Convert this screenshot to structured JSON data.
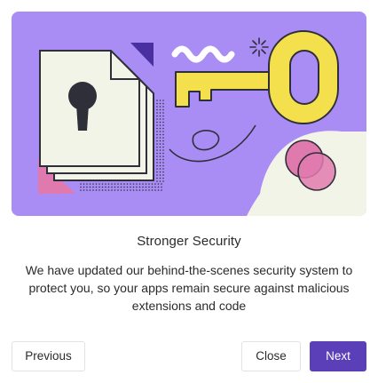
{
  "dialog": {
    "title": "Stronger Security",
    "body": "We have updated our behind-the-scenes security system to protect you, so your apps remain secure against malicious extensions and code",
    "buttons": {
      "previous": "Previous",
      "close": "Close",
      "next": "Next"
    }
  },
  "colors": {
    "hero_background": "#a98df4",
    "primary_button": "#5a3fb8",
    "key_yellow": "#f4e04d",
    "accent_pink": "#e07aae",
    "document_fill": "#f3f4e8",
    "outline": "#2f2f3a"
  },
  "icons": [
    "lock-keyhole-icon",
    "key-icon",
    "sparkle-icon",
    "document-stack-icon"
  ]
}
